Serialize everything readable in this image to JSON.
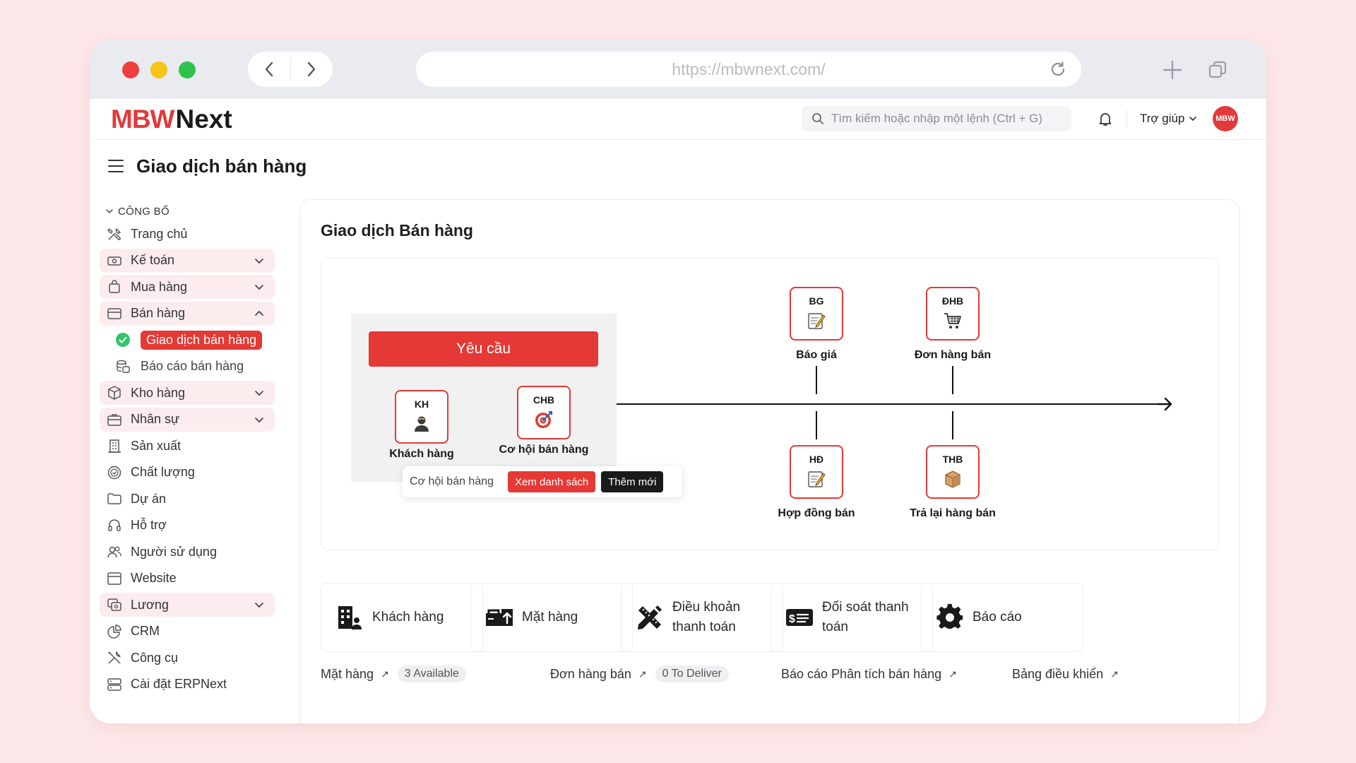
{
  "browser": {
    "url": "https://mbwnext.com/",
    "dots": [
      "#ee3e3e",
      "#f5c518",
      "#2fc24a"
    ]
  },
  "app": {
    "logo_mbw": "MBW",
    "logo_next": "Next",
    "search_placeholder": "Tìm kiếm hoặc nhập một lệnh (Ctrl + G)",
    "help_label": "Trợ giúp",
    "avatar_text": "MBW",
    "accent": "#e53935"
  },
  "page": {
    "title": "Giao dịch bán hàng"
  },
  "sidebar": {
    "section": "CÔNG BỐ",
    "items": [
      {
        "label": "Trang chủ",
        "icon": "tools-icon"
      },
      {
        "label": "Kế toán",
        "icon": "cash-icon",
        "expandable": true
      },
      {
        "label": "Mua hàng",
        "icon": "bag-icon",
        "expandable": true
      },
      {
        "label": "Bán hàng",
        "icon": "card-icon",
        "expandable": true,
        "expanded": true
      },
      {
        "label": "Kho hàng",
        "icon": "box-icon",
        "expandable": true
      },
      {
        "label": "Nhân sự",
        "icon": "briefcase-icon",
        "expandable": true
      },
      {
        "label": "Sản xuất",
        "icon": "building-icon"
      },
      {
        "label": "Chất lượng",
        "icon": "badge-check-icon"
      },
      {
        "label": "Dự án",
        "icon": "folder-icon"
      },
      {
        "label": "Hỗ trợ",
        "icon": "headset-icon"
      },
      {
        "label": "Người sử dụng",
        "icon": "users-icon"
      },
      {
        "label": "Website",
        "icon": "window-icon"
      },
      {
        "label": "Lương",
        "icon": "money-icon",
        "expandable": true
      },
      {
        "label": "CRM",
        "icon": "chart-pie-icon"
      },
      {
        "label": "Công cụ",
        "icon": "wrench-icon"
      },
      {
        "label": "Cài đặt ERPNext",
        "icon": "server-icon"
      }
    ],
    "sub_items": [
      {
        "label": "Giao dịch bán hàng",
        "active": true
      },
      {
        "label": "Báo cáo bán hàng"
      }
    ]
  },
  "main": {
    "card_title": "Giao dịch Bán hàng",
    "request_button": "Yêu cầu",
    "nodes": {
      "kh": {
        "code": "KH",
        "label": "Khách hàng"
      },
      "chb": {
        "code": "CHB",
        "label": "Cơ hội bán hàng"
      },
      "bg": {
        "code": "BG",
        "label": "Báo giá"
      },
      "dhb": {
        "code": "ĐHB",
        "label": "Đơn hàng bán"
      },
      "hd": {
        "code": "HĐ",
        "label": "Hợp đồng bán"
      },
      "thb": {
        "code": "THB",
        "label": "Trả lại hàng bán"
      }
    },
    "tooltip": {
      "label": "Cơ hội bán hàng",
      "view_list": "Xem danh sách",
      "add_new": "Thêm mới"
    },
    "quick_links": [
      {
        "label_1": "Khách hàng",
        "label_2": "",
        "icon": "customer-building-icon"
      },
      {
        "label_1": "Mặt hàng",
        "label_2": "",
        "icon": "item-truck-icon"
      },
      {
        "label_1": "Điều khoản",
        "label_2": "thanh toán",
        "icon": "pencil-ruler-icon"
      },
      {
        "label_1": "Đối soát thanh",
        "label_2": "toán",
        "icon": "money-bill-icon"
      },
      {
        "label_1": "Báo cáo",
        "label_2": "",
        "icon": "gear-icon"
      }
    ],
    "bottom_links": [
      {
        "label": "Mặt hàng",
        "badge": "3 Available"
      },
      {
        "label": "Đơn hàng bán",
        "badge": "0 To Deliver"
      },
      {
        "label": "Báo cáo Phân tích bán hàng",
        "badge": ""
      },
      {
        "label": "Bảng điều khiển",
        "badge": ""
      }
    ]
  }
}
